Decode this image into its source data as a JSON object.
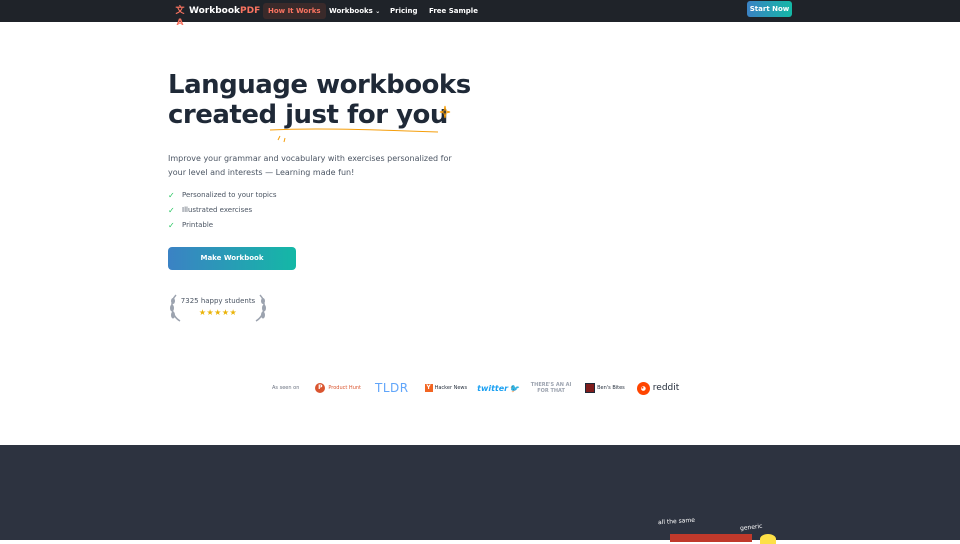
{
  "nav": {
    "logo_main": "Workbook",
    "logo_accent": "PDF",
    "items": [
      {
        "label": "How It Works"
      },
      {
        "label": "Workbooks"
      },
      {
        "label": "Pricing"
      },
      {
        "label": "Free Sample"
      }
    ],
    "cta": "Start Now"
  },
  "hero": {
    "title_line1": "Language workbooks",
    "title_line2": "created just for you",
    "subtitle": "Improve your grammar and vocabulary with exercises personalized for your level and interests — Learning made fun!",
    "features": [
      "Personalized to your topics",
      "Illustrated exercises",
      "Printable"
    ],
    "cta": "Make Workbook",
    "rating_text": "7325 happy students",
    "stars": "★★★★★"
  },
  "as_seen": {
    "label": "As seen on",
    "logos": [
      {
        "name": "Product Hunt",
        "text": "Product Hunt",
        "color": "#da552f"
      },
      {
        "name": "TLDR",
        "text": "TLDR",
        "color": "#60a5fa"
      },
      {
        "name": "Hacker News",
        "text": "Hacker News",
        "color": "#f26522"
      },
      {
        "name": "twitter",
        "text": "twitter",
        "color": "#1da1f2"
      },
      {
        "name": "There's an AI for that",
        "text": "THERE'S AN AI FOR THAT"
      },
      {
        "name": "Ben's Bites",
        "text": "Ben's Bites"
      },
      {
        "name": "reddit",
        "text": "reddit",
        "color": "#ff4500"
      }
    ]
  },
  "next_section": {
    "note_1": "all the same",
    "note_2": "generic"
  },
  "colors": {
    "nav_bg": "#1f2329",
    "accent": "#f97360",
    "gradient_start": "#3b82c4",
    "gradient_end": "#14b8a6",
    "dark_section": "#2d3340"
  }
}
